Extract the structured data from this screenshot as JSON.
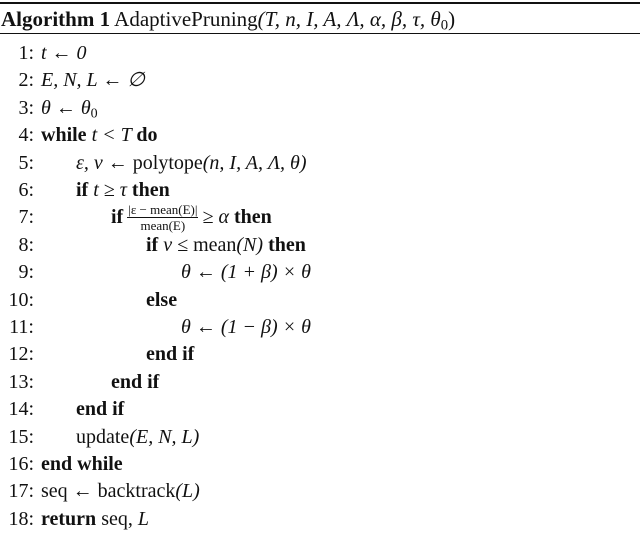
{
  "algorithm": {
    "label": "Algorithm 1",
    "name": "AdaptivePruning",
    "params": "(T, n, I, A, Λ, α, β, τ, θ",
    "params_sub": "0",
    "params_close": ")"
  },
  "lines": [
    {
      "no": "1:",
      "indent": 0,
      "parts": [
        {
          "t": "t ← 0",
          "s": "m"
        }
      ]
    },
    {
      "no": "2:",
      "indent": 0,
      "parts": [
        {
          "t": "E, N, L ← ∅",
          "s": "m"
        }
      ]
    },
    {
      "no": "3:",
      "indent": 0,
      "parts": [
        {
          "t": "θ ← θ",
          "s": "m"
        },
        {
          "t": "0",
          "s": "sub"
        }
      ]
    },
    {
      "no": "4:",
      "indent": 0,
      "parts": [
        {
          "t": "while ",
          "s": "kw"
        },
        {
          "t": "t < T ",
          "s": "m"
        },
        {
          "t": "do",
          "s": "kw"
        }
      ]
    },
    {
      "no": "5:",
      "indent": 1,
      "parts": [
        {
          "t": "ε, ν ← ",
          "s": "m"
        },
        {
          "t": "polytope",
          "s": "rm"
        },
        {
          "t": "(n, I, A, Λ, θ)",
          "s": "m"
        }
      ]
    },
    {
      "no": "6:",
      "indent": 1,
      "parts": [
        {
          "t": "if ",
          "s": "kw"
        },
        {
          "t": "t ≥ τ ",
          "s": "m"
        },
        {
          "t": "then",
          "s": "kw"
        }
      ]
    },
    {
      "no": "7:",
      "indent": 2,
      "parts": [
        {
          "t": "if",
          "s": "kw"
        },
        {
          "t": "FRAC",
          "s": "frac",
          "num": "|ε − mean(E)|",
          "den": "mean(E)"
        },
        {
          "t": "≥ α ",
          "s": "m"
        },
        {
          "t": "then",
          "s": "kw"
        }
      ]
    },
    {
      "no": "8:",
      "indent": 3,
      "parts": [
        {
          "t": "if ",
          "s": "kw"
        },
        {
          "t": "ν ≤ ",
          "s": "m"
        },
        {
          "t": "mean",
          "s": "rm"
        },
        {
          "t": "(N) ",
          "s": "m"
        },
        {
          "t": "then",
          "s": "kw"
        }
      ]
    },
    {
      "no": "9:",
      "indent": 4,
      "parts": [
        {
          "t": "θ ← (1 + β) × θ",
          "s": "m"
        }
      ]
    },
    {
      "no": "10:",
      "indent": 3,
      "parts": [
        {
          "t": "else",
          "s": "kw"
        }
      ]
    },
    {
      "no": "11:",
      "indent": 4,
      "parts": [
        {
          "t": "θ ← (1 − β) × θ",
          "s": "m"
        }
      ]
    },
    {
      "no": "12:",
      "indent": 3,
      "parts": [
        {
          "t": "end if",
          "s": "kw"
        }
      ]
    },
    {
      "no": "13:",
      "indent": 2,
      "parts": [
        {
          "t": "end if",
          "s": "kw"
        }
      ]
    },
    {
      "no": "14:",
      "indent": 1,
      "parts": [
        {
          "t": "end if",
          "s": "kw"
        }
      ]
    },
    {
      "no": "15:",
      "indent": 1,
      "parts": [
        {
          "t": "update",
          "s": "rm"
        },
        {
          "t": "(E, N, L)",
          "s": "m"
        }
      ]
    },
    {
      "no": "16:",
      "indent": 0,
      "parts": [
        {
          "t": "end while",
          "s": "kw"
        }
      ]
    },
    {
      "no": "17:",
      "indent": 0,
      "parts": [
        {
          "t": "seq ← backtrack",
          "s": "rm"
        },
        {
          "t": "(L)",
          "s": "m"
        }
      ]
    },
    {
      "no": "18:",
      "indent": 0,
      "parts": [
        {
          "t": "return ",
          "s": "kw"
        },
        {
          "t": "seq, ",
          "s": "rm"
        },
        {
          "t": "L",
          "s": "m"
        }
      ]
    }
  ]
}
